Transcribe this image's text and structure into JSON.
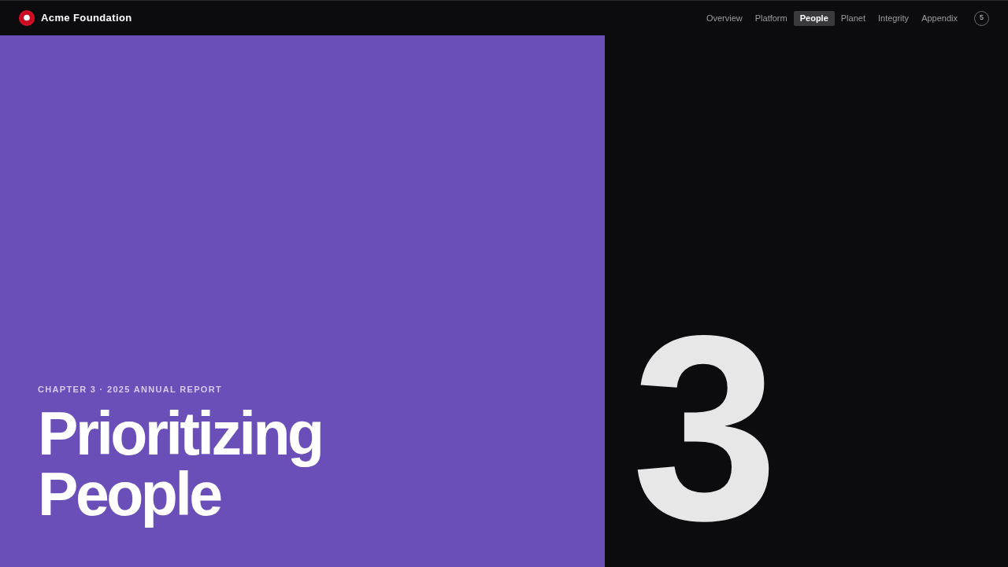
{
  "header": {
    "brand": "Acme Foundation",
    "nav": [
      {
        "label": "Overview",
        "selected": false
      },
      {
        "label": "Platform",
        "selected": false
      },
      {
        "label": "People",
        "selected": true
      },
      {
        "label": "Planet",
        "selected": false
      },
      {
        "label": "Integrity",
        "selected": false
      },
      {
        "label": "Appendix",
        "selected": false
      }
    ],
    "page_indicator": "5"
  },
  "cover": {
    "eyebrow": "CHAPTER 3 · 2025 ANNUAL REPORT",
    "title": "Prioritizing People",
    "chapter_number": "3"
  }
}
